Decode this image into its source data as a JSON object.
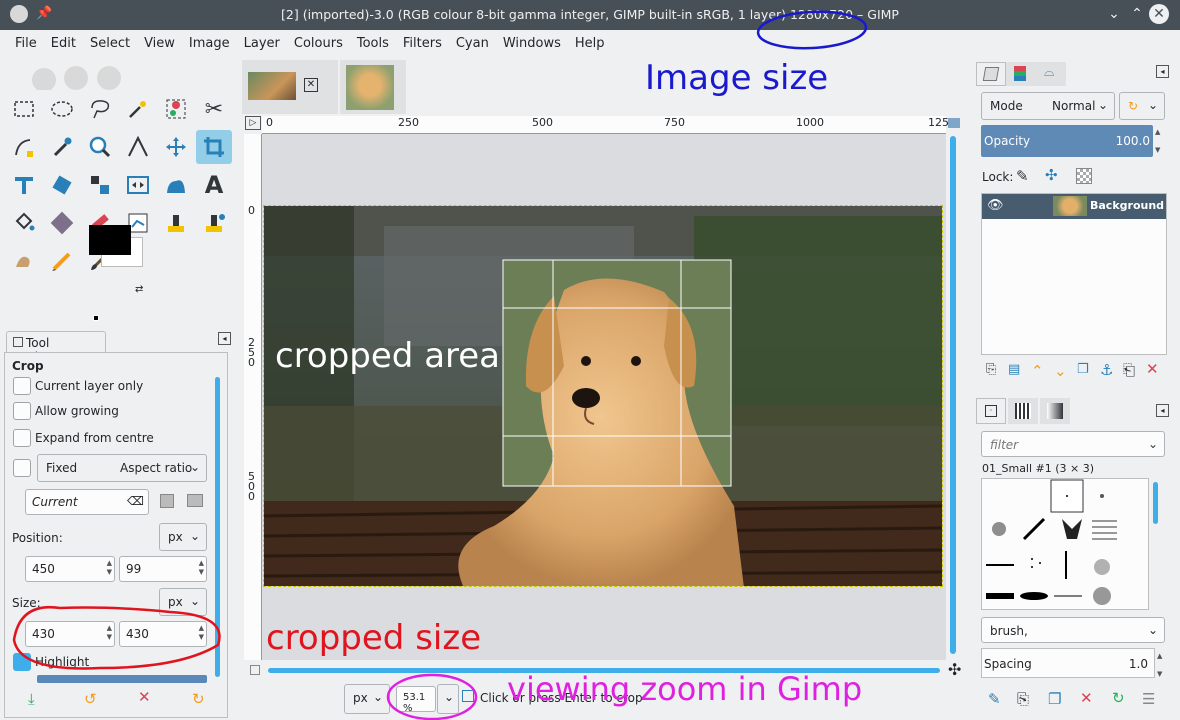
{
  "window": {
    "title": "[2] (imported)-3.0 (RGB colour 8-bit gamma integer, GIMP built-in sRGB, 1 layer) 1280x720 – GIMP"
  },
  "menu": [
    "File",
    "Edit",
    "Select",
    "View",
    "Image",
    "Layer",
    "Colours",
    "Tools",
    "Filters",
    "Cyan",
    "Windows",
    "Help"
  ],
  "tool_options": {
    "tab_label": "Tool Options",
    "section": "Crop",
    "current_layer_only": "Current layer only",
    "allow_growing": "Allow growing",
    "expand_from_centre": "Expand from centre",
    "fixed": "Fixed",
    "aspect_ratio": "Aspect ratio",
    "current": "Current",
    "position_label": "Position:",
    "position_unit": "px",
    "position_x": "450",
    "position_y": "99",
    "size_label": "Size:",
    "size_unit": "px",
    "size_w": "430",
    "size_h": "430",
    "highlight": "Highlight"
  },
  "ruler": {
    "h_ticks": [
      "0",
      "250",
      "500",
      "750",
      "1000",
      "125"
    ],
    "v_ticks": [
      "0",
      "250",
      "500"
    ]
  },
  "status": {
    "unit": "px",
    "zoom": "53.1 %",
    "message": "Click or press Enter to crop"
  },
  "layers": {
    "mode_label": "Mode",
    "mode_value": "Normal",
    "opacity_label": "Opacity",
    "opacity_value": "100.0",
    "lock_label": "Lock:",
    "layer_name": "Background"
  },
  "brushes": {
    "filter_placeholder": "filter",
    "brush_title": "01_Small #1 (3 × 3)",
    "brush_tag": "brush,",
    "spacing_label": "Spacing",
    "spacing_value": "1.0"
  },
  "annotations": {
    "image_size": "Image size",
    "cropped_area": "cropped area",
    "cropped_size": "cropped size",
    "viewing_zoom": "viewing zoom in Gimp"
  },
  "colors": {
    "accent": "#3daee9",
    "annot_blue": "#1a1acc",
    "annot_red": "#e0141e",
    "annot_magenta": "#e020e0"
  }
}
